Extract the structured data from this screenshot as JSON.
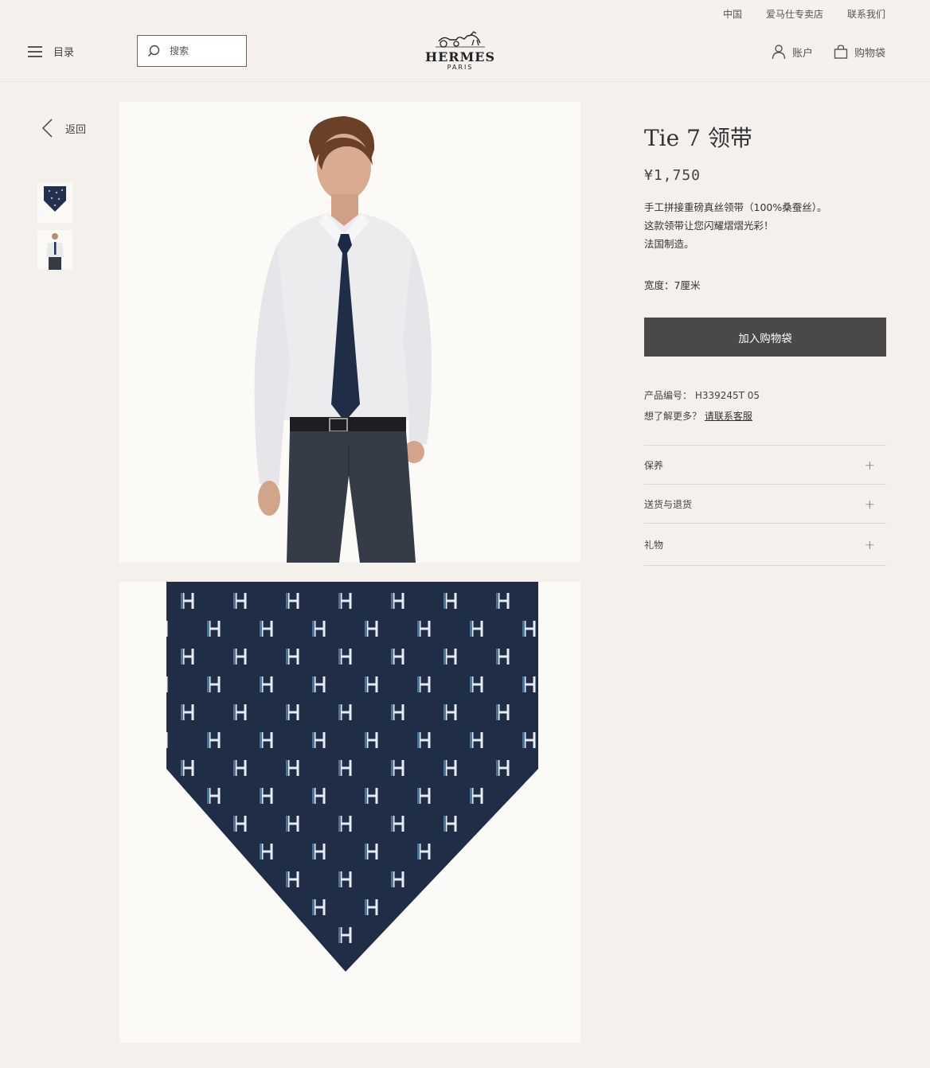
{
  "utility_links": [
    "中国",
    "爱马仕专卖店",
    "联系我们"
  ],
  "header": {
    "menu_label": "目录",
    "search_placeholder": "搜索",
    "logo_name": "HERMES",
    "logo_sub": "PARIS",
    "account_label": "账户",
    "bag_label": "购物袋"
  },
  "back_label": "返回",
  "product": {
    "title": "Tie 7 领带",
    "price": "¥1,750",
    "description": [
      "手工拼接重磅真丝领带（100%桑蚕丝）。",
      "这款领带让您闪耀熠熠光彩！",
      "法国制造。"
    ],
    "width": "宽度：7厘米",
    "add_to_bag": "加入购物袋",
    "sku": "产品编号： H339245T 05",
    "more_prefix": "想了解更多？",
    "more_link": "请联系客服"
  },
  "accordion": [
    "保养",
    "送货与退货",
    "礼物"
  ],
  "colors": {
    "navy": "#1f2d47",
    "button": "#4a4948",
    "background": "#f4f1ec"
  },
  "icons": [
    "menu-icon",
    "search-icon",
    "user-icon",
    "bag-icon",
    "chevron-left-icon",
    "plus-icon"
  ]
}
